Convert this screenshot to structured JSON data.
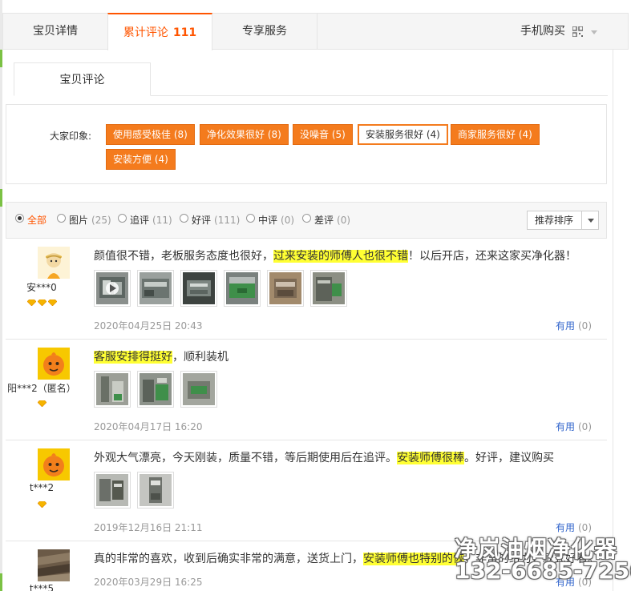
{
  "tabs": {
    "details": "宝贝详情",
    "reviews_label": "累计评论",
    "reviews_count": "111",
    "service": "专享服务",
    "mobile_buy": "手机购买"
  },
  "subtab": "宝贝评论",
  "impressions": {
    "label": "大家印象:",
    "tags": [
      "使用感受极佳 (8)",
      "净化效果很好 (8)",
      "没噪音 (5)",
      "安装服务很好 (4)",
      "商家服务很好 (4)",
      "安装方便 (4)"
    ],
    "selected_index": 3
  },
  "filters": [
    {
      "label": "全部",
      "count": "",
      "checked": true
    },
    {
      "label": "图片",
      "count": "(25)",
      "checked": false
    },
    {
      "label": "追评",
      "count": "(11)",
      "checked": false
    },
    {
      "label": "好评",
      "count": "(111)",
      "checked": false
    },
    {
      "label": "中评",
      "count": "(0)",
      "checked": false
    },
    {
      "label": "差评",
      "count": "(0)",
      "checked": false
    }
  ],
  "sort": {
    "label": "推荐排序"
  },
  "reviews": [
    {
      "user": "安***0",
      "gem_count": 3,
      "text_pre": "颜值很不错，老板服务态度也很好，",
      "text_hl": "过来安装的师傅人也很不错",
      "text_post": "！以后开店，还来这家买净化器！",
      "photo_count": 6,
      "date": "2020年04月25日 20:43",
      "useful": "有用",
      "useful_count": "(0)"
    },
    {
      "user": "阳***2（匿名）",
      "gem_count": 1,
      "text_pre": "",
      "text_hl": "客服安排得挺好",
      "text_post": "，顺利装机",
      "photo_count": 3,
      "date": "2020年04月17日 16:20",
      "useful": "有用",
      "useful_count": "(0)"
    },
    {
      "user": "t***2",
      "gem_count": 1,
      "text_pre": "外观大气漂亮，今天刚装，质量不错，等后期使用后在追评。",
      "text_hl": "安装师傅很棒",
      "text_post": "。好评，建议购买",
      "photo_count": 2,
      "date": "2019年12月16日 21:11",
      "useful": "有用",
      "useful_count": "(0)"
    },
    {
      "user": "t***5",
      "gem_count": 0,
      "text_pre": "真的非常的喜欢，收到后确实非常的满意，送货上门，",
      "text_hl": "安装师傅也特别的恢",
      "text_post": "，非常的给力，款式好看。",
      "photo_count": 0,
      "date": "2020年03月29日 16:25",
      "useful": "有用",
      "useful_count": "(0)"
    }
  ],
  "watermark": {
    "line1": "净岚油烟净化器",
    "line2": "132-6685-7256"
  }
}
